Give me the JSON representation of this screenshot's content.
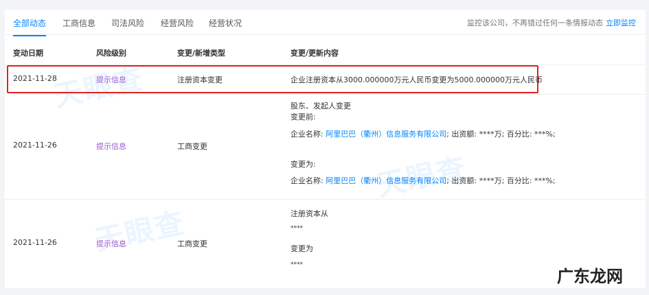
{
  "tabs": [
    "全部动态",
    "工商信息",
    "司法风险",
    "经营风险",
    "经营状况"
  ],
  "monitor": {
    "text": "监控该公司，不再错过任何一条情报动态",
    "link": "立即监控"
  },
  "columns": [
    "变动日期",
    "风险级别",
    "变更/新增类型",
    "变更/更新内容"
  ],
  "rows": [
    {
      "date": "2021-11-28",
      "risk": "提示信息",
      "type": "注册资本变更",
      "content": "企业注册资本从3000.000000万元人民币变更为5000.000000万元人民币"
    },
    {
      "date": "2021-11-26",
      "risk": "提示信息",
      "type": "工商变更",
      "title": "股东、发起人变更",
      "before_label": "变更前:",
      "after_label": "变更为:",
      "name_label": "企业名称:",
      "company": "阿里巴巴（衢州）信息服务有限公司",
      "rest": "; 出资额: ****万; 百分比: ***%;"
    },
    {
      "date": "2021-11-26",
      "risk": "提示信息",
      "type": "工商变更",
      "l1": "注册资本从",
      "l2": "****",
      "l3": "变更为",
      "l4": "****"
    }
  ],
  "watermark": "天眼查",
  "corner_watermark": "广东龙网"
}
